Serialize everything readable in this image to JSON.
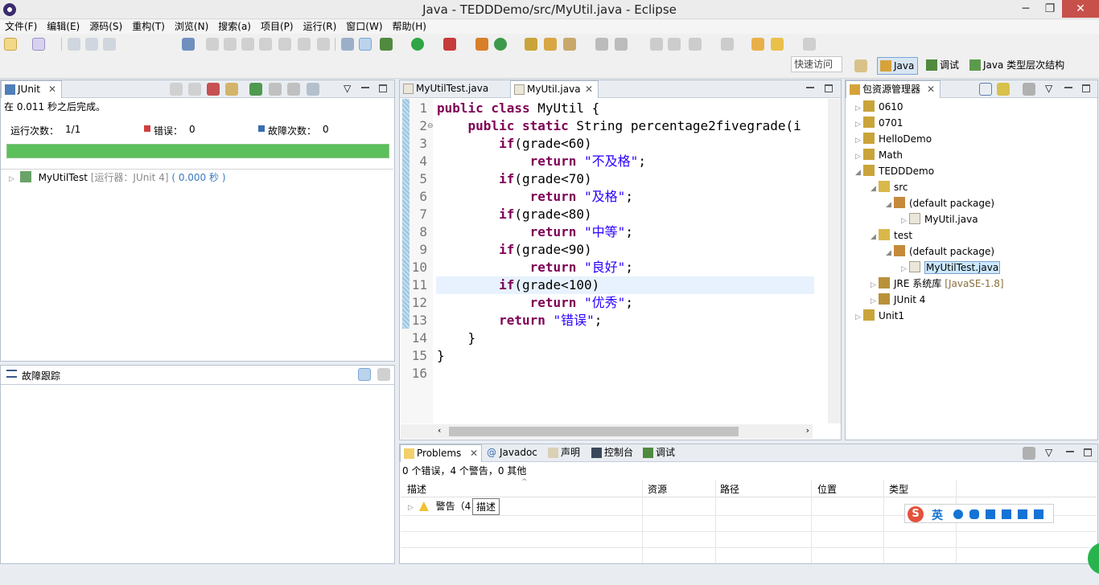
{
  "window": {
    "title": "Java - TEDDDemo/src/MyUtil.java - Eclipse",
    "min_label": "─",
    "restore_label": "❐",
    "close_label": "✕"
  },
  "menu": [
    "文件(F)",
    "编辑(E)",
    "源码(S)",
    "重构(T)",
    "浏览(N)",
    "搜索(a)",
    "项目(P)",
    "运行(R)",
    "窗口(W)",
    "帮助(H)"
  ],
  "quick_access": "快速访问",
  "perspectives": [
    {
      "label": "Java",
      "active": true
    },
    {
      "label": "调试",
      "active": false
    },
    {
      "label": "Java 类型层次结构",
      "active": false
    }
  ],
  "junit": {
    "tab_label": "JUnit",
    "status": "在 0.011 秒之后完成。",
    "runs_label": "运行次数：",
    "runs_value": "1/1",
    "errors_label": "错误：",
    "errors_value": "0",
    "failures_label": "故障次数：",
    "failures_value": "0",
    "progress": 1.0,
    "progress_color": "#5bbf5b",
    "test_name": "MyUtilTest",
    "test_runner": "[运行器：JUnit 4]",
    "test_time": "( 0.000 秒 )",
    "trace_label": "故障跟踪"
  },
  "editor": {
    "tabs": [
      "MyUtilTest.java",
      "MyUtil.java"
    ],
    "active_tab": 1,
    "lines": [
      {
        "n": "1",
        "tokens": [
          {
            "t": "public class ",
            "c": "kw"
          },
          {
            "t": "MyUtil {",
            "c": ""
          }
        ]
      },
      {
        "n": "2",
        "tokens": [
          {
            "t": "    ",
            "c": ""
          },
          {
            "t": "public static ",
            "c": "kw"
          },
          {
            "t": "String percentage2fivegrade(i",
            "c": ""
          }
        ]
      },
      {
        "n": "3",
        "tokens": [
          {
            "t": "        ",
            "c": ""
          },
          {
            "t": "if",
            "c": "kw"
          },
          {
            "t": "(grade<60)",
            "c": ""
          }
        ]
      },
      {
        "n": "4",
        "tokens": [
          {
            "t": "            ",
            "c": ""
          },
          {
            "t": "return ",
            "c": "kw"
          },
          {
            "t": "\"不及格\"",
            "c": "str"
          },
          {
            "t": ";",
            "c": ""
          }
        ]
      },
      {
        "n": "5",
        "tokens": [
          {
            "t": "        ",
            "c": ""
          },
          {
            "t": "if",
            "c": "kw"
          },
          {
            "t": "(grade<70)",
            "c": ""
          }
        ]
      },
      {
        "n": "6",
        "tokens": [
          {
            "t": "            ",
            "c": ""
          },
          {
            "t": "return ",
            "c": "kw"
          },
          {
            "t": "\"及格\"",
            "c": "str"
          },
          {
            "t": ";",
            "c": ""
          }
        ]
      },
      {
        "n": "7",
        "tokens": [
          {
            "t": "        ",
            "c": ""
          },
          {
            "t": "if",
            "c": "kw"
          },
          {
            "t": "(grade<80)",
            "c": ""
          }
        ]
      },
      {
        "n": "8",
        "tokens": [
          {
            "t": "            ",
            "c": ""
          },
          {
            "t": "return ",
            "c": "kw"
          },
          {
            "t": "\"中等\"",
            "c": "str"
          },
          {
            "t": ";",
            "c": ""
          }
        ]
      },
      {
        "n": "9",
        "tokens": [
          {
            "t": "        ",
            "c": ""
          },
          {
            "t": "if",
            "c": "kw"
          },
          {
            "t": "(grade<90)",
            "c": ""
          }
        ]
      },
      {
        "n": "10",
        "tokens": [
          {
            "t": "            ",
            "c": ""
          },
          {
            "t": "return ",
            "c": "kw"
          },
          {
            "t": "\"良好\"",
            "c": "str"
          },
          {
            "t": ";",
            "c": ""
          }
        ]
      },
      {
        "n": "11",
        "tokens": [
          {
            "t": "        ",
            "c": ""
          },
          {
            "t": "if",
            "c": "kw"
          },
          {
            "t": "(grade<100)",
            "c": ""
          }
        ]
      },
      {
        "n": "12",
        "tokens": [
          {
            "t": "            ",
            "c": ""
          },
          {
            "t": "return ",
            "c": "kw"
          },
          {
            "t": "\"优秀\"",
            "c": "str"
          },
          {
            "t": ";",
            "c": ""
          }
        ]
      },
      {
        "n": "13",
        "tokens": [
          {
            "t": "        ",
            "c": ""
          },
          {
            "t": "return ",
            "c": "kw"
          },
          {
            "t": "\"错误\"",
            "c": "str"
          },
          {
            "t": ";",
            "c": ""
          }
        ]
      },
      {
        "n": "14",
        "tokens": [
          {
            "t": "    }",
            "c": ""
          }
        ]
      },
      {
        "n": "15",
        "tokens": [
          {
            "t": "}",
            "c": ""
          }
        ]
      },
      {
        "n": "16",
        "tokens": []
      }
    ],
    "current_line": 11
  },
  "package_explorer": {
    "tab_label": "包资源管理器",
    "items": [
      {
        "label": "0610",
        "depth": 0,
        "twist": "▷",
        "icon": "project-icon"
      },
      {
        "label": "0701",
        "depth": 0,
        "twist": "▷",
        "icon": "project-icon"
      },
      {
        "label": "HelloDemo",
        "depth": 0,
        "twist": "▷",
        "icon": "project-icon"
      },
      {
        "label": "Math",
        "depth": 0,
        "twist": "▷",
        "icon": "project-icon"
      },
      {
        "label": "TEDDDemo",
        "depth": 0,
        "twist": "◢",
        "icon": "project-icon"
      },
      {
        "label": "src",
        "depth": 1,
        "twist": "◢",
        "icon": "source-folder-icon"
      },
      {
        "label": "(default package)",
        "depth": 2,
        "twist": "◢",
        "icon": "package-icon"
      },
      {
        "label": "MyUtil.java",
        "depth": 3,
        "twist": "▷",
        "icon": "java-file-icon"
      },
      {
        "label": "test",
        "depth": 1,
        "twist": "◢",
        "icon": "source-folder-icon"
      },
      {
        "label": "(default package)",
        "depth": 2,
        "twist": "◢",
        "icon": "package-icon"
      },
      {
        "label": "MyUtilTest.java",
        "depth": 3,
        "twist": "▷",
        "icon": "java-file-icon",
        "selected": true
      },
      {
        "label": "JRE 系统库",
        "suffix": "[JavaSE-1.8]",
        "depth": 1,
        "twist": "▷",
        "icon": "library-icon"
      },
      {
        "label": "JUnit 4",
        "depth": 1,
        "twist": "▷",
        "icon": "library-icon"
      },
      {
        "label": "Unit1",
        "depth": 0,
        "twist": "▷",
        "icon": "project-icon"
      }
    ]
  },
  "bottom": {
    "tabs": [
      "Problems",
      "Javadoc",
      "声明",
      "控制台",
      "调试"
    ],
    "status": "0 个错误，4 个警告，0 其他",
    "columns": [
      "描述",
      "资源",
      "路径",
      "位置",
      "类型"
    ],
    "row_label": "警告（4",
    "tooltip": "描述"
  },
  "ime": {
    "logo": "S",
    "lang": "英"
  },
  "colors": {
    "keyword": "#7f0055",
    "string": "#2a00ff",
    "selection": "#cce8ff",
    "progress": "#5bbf5b"
  }
}
